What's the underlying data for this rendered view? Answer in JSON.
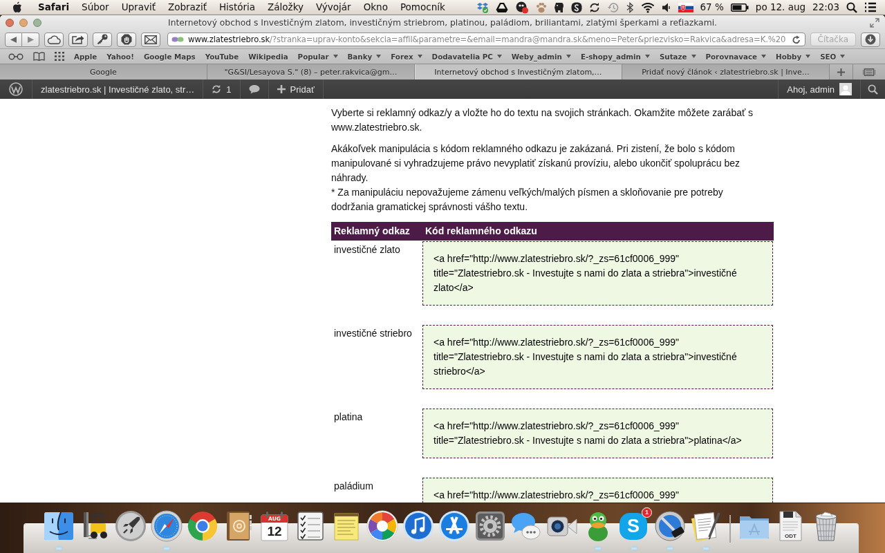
{
  "menu_bar": {
    "app": "Safari",
    "menus": [
      "Súbor",
      "Upraviť",
      "Zobraziť",
      "História",
      "Záložky",
      "Vývojár",
      "Okno",
      "Pomocník"
    ],
    "battery": "67 %",
    "date": "po 12. aug",
    "time": "22:03"
  },
  "window": {
    "title": "Internetový obchod s Investičným zlatom, investičným striebrom, platinou, paládiom, briliantami, zlatými šperkami a reťiazkami."
  },
  "toolbar": {
    "url_host": "www.zlatestriebro.sk",
    "url_path": "/?stranka=uprav-konto&sekcia=affil&parametre=&email=mandra@mandra.sk&meno=Peter&priezvisko=Rakvica&adresa=K.%20",
    "reader": {
      "label": "Čítačka",
      "disabled": true
    }
  },
  "bookmarks": [
    {
      "label": "Apple",
      "kind": "link"
    },
    {
      "label": "Yahoo!",
      "kind": "link"
    },
    {
      "label": "Google Maps",
      "kind": "link"
    },
    {
      "label": "YouTube",
      "kind": "link"
    },
    {
      "label": "Wikipedia",
      "kind": "link"
    },
    {
      "label": "Popular",
      "kind": "folder"
    },
    {
      "label": "Banky",
      "kind": "folder"
    },
    {
      "label": "Forex",
      "kind": "folder"
    },
    {
      "label": "Dodavatelia PC",
      "kind": "folder"
    },
    {
      "label": "Weby_admin",
      "kind": "folder"
    },
    {
      "label": "E-shopy_admin",
      "kind": "folder"
    },
    {
      "label": "Sutaze",
      "kind": "folder"
    },
    {
      "label": "Porovnavace",
      "kind": "folder"
    },
    {
      "label": "Hobby",
      "kind": "folder"
    },
    {
      "label": "SEO",
      "kind": "folder"
    }
  ],
  "tabs": [
    {
      "label": "Google",
      "selected": false
    },
    {
      "label": "\"G&SI/Lesayova S.\" (8) – peter.rakvica@gm…",
      "selected": false
    },
    {
      "label": "Internetový obchod s Investičným zlatom,…",
      "selected": true
    },
    {
      "label": "Pridať nový článok ‹ zlatestriebro.sk | Inve…",
      "selected": false
    }
  ],
  "admin_bar": {
    "site": "zlatestriebro.sk | Investičné zlato, str…",
    "updates": "1",
    "add": "Pridať",
    "greeting": "Ahoj, admin"
  },
  "content": {
    "paragraphs": [
      [
        "Vyberte si reklamný odkaz/y a vložte ho do textu na svojich stránkach. Okamžite môžete zarábať s www.zlatestriebro.sk."
      ],
      [
        "Akákoľvek manipulácia s kódom reklamného odkazu je zakázaná. Pri zistení, že bolo s kódom manipulované si vyhradzujeme právo nevyplatiť získanú províziu, alebo ukončiť spoluprácu bez náhrady.",
        "* Za manipuláciu nepovažujeme zámenu veľkých/malých písmen a skloňovanie pre potreby dodržania gramatickej správnosti vášho textu."
      ]
    ],
    "table": {
      "columns": [
        "Reklamný odkaz",
        "Kód reklamného odkazu"
      ],
      "rows": [
        {
          "name": "investičné zlato",
          "code": "<a href=\"http://www.zlatestriebro.sk/?_zs=61cf0006_999\" title=\"Zlatestriebro.sk - Investujte s nami do zlata a striebra\">investičné zlato</a>"
        },
        {
          "name": "investičné striebro",
          "code": "<a href=\"http://www.zlatestriebro.sk/?_zs=61cf0006_999\" title=\"Zlatestriebro.sk - Investujte s nami do zlata a striebra\">investičné striebro</a>"
        },
        {
          "name": "platina",
          "code": "<a href=\"http://www.zlatestriebro.sk/?_zs=61cf0006_999\" title=\"Zlatestriebro.sk - Investujte s nami do zlata a striebra\">platina</a>"
        },
        {
          "name": "paládium",
          "code": "<a href=\"http://www.zlatestriebro.sk/?_zs=61cf0006_999\""
        }
      ]
    }
  },
  "dock": [
    {
      "kind": "finder",
      "running": true
    },
    {
      "kind": "forklift",
      "running": false
    },
    {
      "kind": "launchpad",
      "running": false
    },
    {
      "kind": "safari",
      "running": true
    },
    {
      "kind": "chrome",
      "running": false
    },
    {
      "kind": "contacts",
      "running": false
    },
    {
      "kind": "calendar",
      "month": "AUG",
      "day": "12",
      "running": false
    },
    {
      "kind": "reminders",
      "running": false
    },
    {
      "kind": "notes",
      "running": false
    },
    {
      "kind": "picasa",
      "running": false
    },
    {
      "kind": "itunes",
      "running": false
    },
    {
      "kind": "appstore",
      "running": false
    },
    {
      "kind": "preferences",
      "running": false
    },
    {
      "kind": "messages",
      "running": false
    },
    {
      "kind": "facetime",
      "running": false
    },
    {
      "kind": "adium",
      "running": true
    },
    {
      "kind": "skype",
      "letter": "S",
      "badge": "1",
      "running": true
    },
    {
      "kind": "keychain",
      "running": true
    },
    {
      "kind": "textedit",
      "running": true
    },
    {
      "kind": "separator"
    },
    {
      "kind": "folder",
      "running": false
    },
    {
      "kind": "document",
      "label": "ODT",
      "running": false
    },
    {
      "kind": "trash",
      "running": false
    }
  ]
}
